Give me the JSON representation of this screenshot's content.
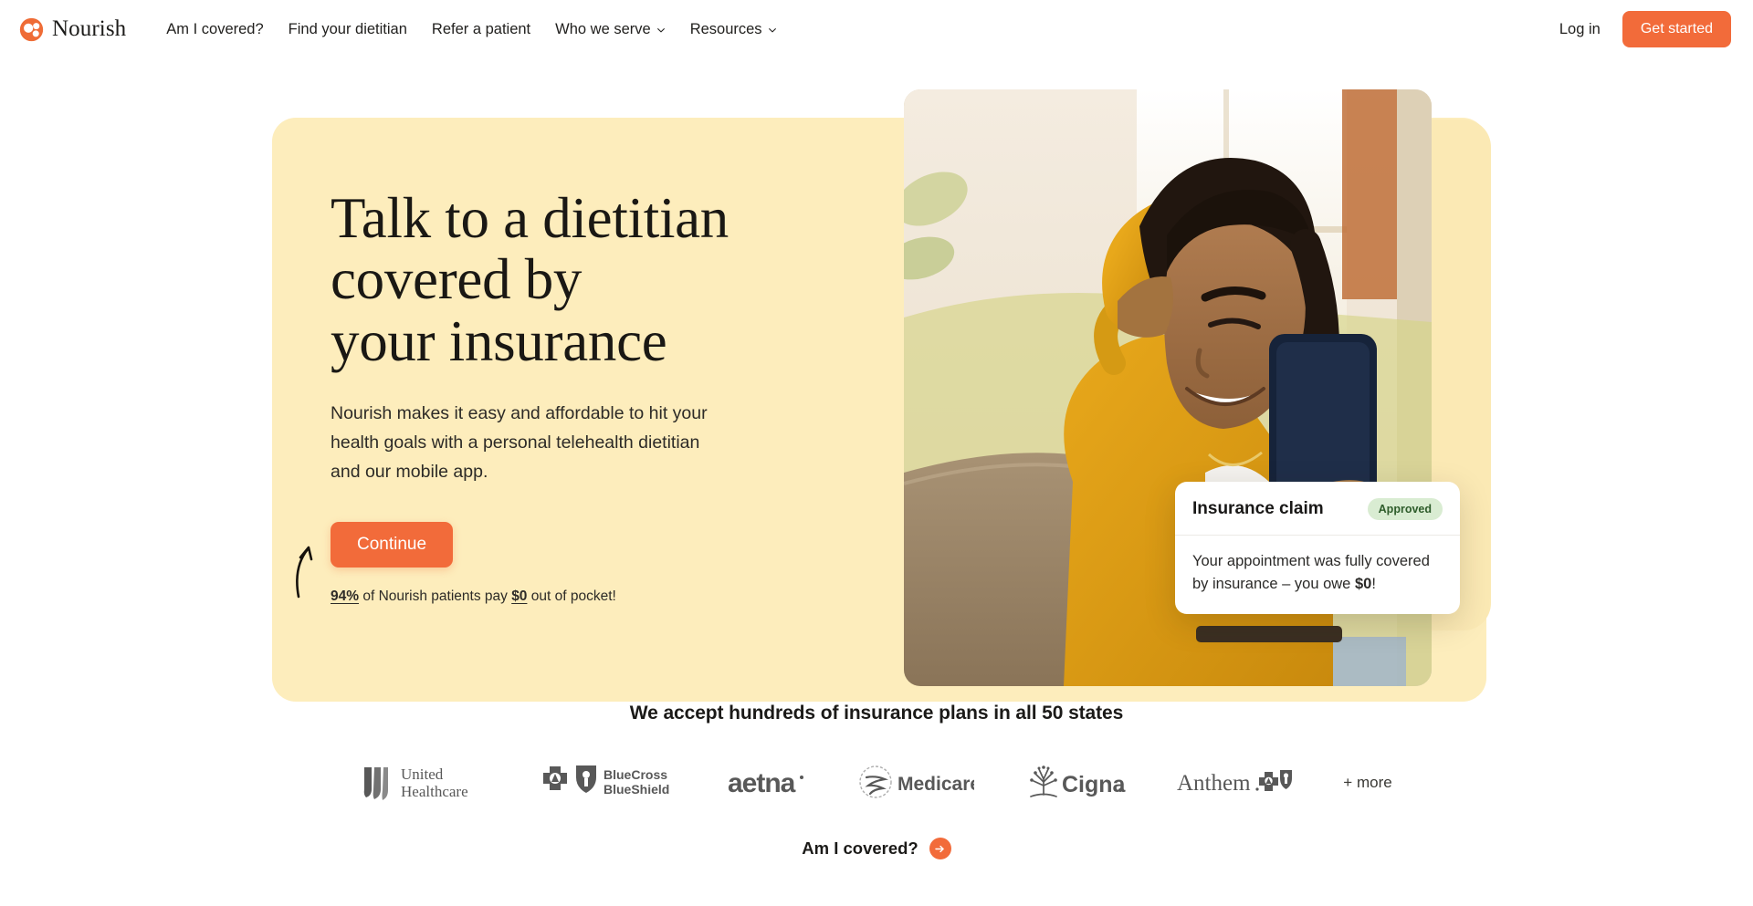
{
  "brand": {
    "name": "Nourish",
    "logo_icon": "nourish-dots-logo",
    "accent_color": "#f26b3a"
  },
  "nav": {
    "links": [
      {
        "label": "Am I covered?",
        "has_chevron": false
      },
      {
        "label": "Find your dietitian",
        "has_chevron": false
      },
      {
        "label": "Refer a patient",
        "has_chevron": false
      },
      {
        "label": "Who we serve",
        "has_chevron": true
      },
      {
        "label": "Resources",
        "has_chevron": true
      }
    ],
    "login_label": "Log in",
    "cta_label": "Get started"
  },
  "hero": {
    "title_lines": [
      "Talk to a dietitian",
      "covered by",
      "your insurance"
    ],
    "subtitle": "Nourish makes it easy and affordable to hit your health goals with a personal telehealth dietitian and our mobile app.",
    "cta_label": "Continue",
    "stat": {
      "percent": "94%",
      "mid_text": " of Nourish patients pay ",
      "amount": "$0",
      "end_text": " out of pocket!"
    },
    "panel_color": "#fdedbc",
    "photo_alt": "Smiling woman on couch looking at her phone"
  },
  "claim_card": {
    "title": "Insurance claim",
    "badge": "Approved",
    "badge_color": "#d9ecd2",
    "body_prefix": "Your appointment was fully covered by insurance – you owe ",
    "body_amount": "$0",
    "body_suffix": "!"
  },
  "logos_section": {
    "heading": "We accept hundreds of insurance plans in all 50 states",
    "logos": [
      {
        "name": "united-healthcare",
        "label": "UnitedHealthcare"
      },
      {
        "name": "bluecross-blueshield",
        "label": "BlueCross BlueShield"
      },
      {
        "name": "aetna",
        "label": "aetna"
      },
      {
        "name": "medicare",
        "label": "Medicare"
      },
      {
        "name": "cigna",
        "label": "Cigna"
      },
      {
        "name": "anthem",
        "label": "Anthem"
      }
    ],
    "more_label": "+ more",
    "covered_label": "Am I covered?",
    "covered_icon": "arrow-right-circle-icon"
  }
}
